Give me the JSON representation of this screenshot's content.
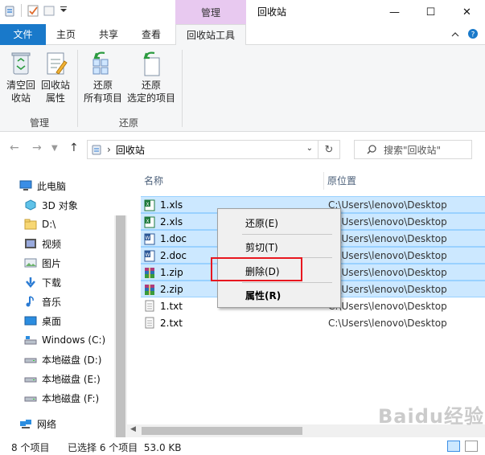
{
  "window": {
    "title": "回收站",
    "contextual_tab_group": "管理",
    "minimize": "—",
    "maximize": "☐",
    "close": "✕"
  },
  "tabs": {
    "file": "文件",
    "home": "主页",
    "share": "共享",
    "view": "查看",
    "recycle_tools": "回收站工具"
  },
  "ribbon": {
    "empty_bin_line1": "清空回",
    "empty_bin_line2": "收站",
    "bin_props_line1": "回收站",
    "bin_props_line2": "属性",
    "group_manage": "管理",
    "restore_all_line1": "还原",
    "restore_all_line2": "所有项目",
    "restore_sel_line1": "还原",
    "restore_sel_line2": "选定的项目",
    "group_restore": "还原"
  },
  "address": {
    "path": "回收站",
    "search_placeholder": "搜索\"回收站\""
  },
  "nav": {
    "items": [
      {
        "label": "此电脑"
      },
      {
        "label": "3D 对象"
      },
      {
        "label": "D:\\"
      },
      {
        "label": "视频"
      },
      {
        "label": "图片"
      },
      {
        "label": "下载"
      },
      {
        "label": "音乐"
      },
      {
        "label": "桌面"
      },
      {
        "label": "Windows (C:)"
      },
      {
        "label": "本地磁盘 (D:)"
      },
      {
        "label": "本地磁盘 (E:)"
      },
      {
        "label": "本地磁盘 (F:)"
      },
      {
        "label": "网络"
      }
    ]
  },
  "columns": {
    "name": "名称",
    "location": "原位置"
  },
  "files": [
    {
      "name": "1.xls",
      "location": "C:\\Users\\lenovo\\Desktop",
      "selected": true,
      "type": "xls"
    },
    {
      "name": "2.xls",
      "location": "C:\\Users\\lenovo\\Desktop",
      "selected": true,
      "type": "xls"
    },
    {
      "name": "1.doc",
      "location": "C:\\Users\\lenovo\\Desktop",
      "selected": true,
      "type": "doc"
    },
    {
      "name": "2.doc",
      "location": "C:\\Users\\lenovo\\Desktop",
      "selected": true,
      "type": "doc"
    },
    {
      "name": "1.zip",
      "location": "C:\\Users\\lenovo\\Desktop",
      "selected": true,
      "type": "zip"
    },
    {
      "name": "2.zip",
      "location": "C:\\Users\\lenovo\\Desktop",
      "selected": true,
      "type": "zip"
    },
    {
      "name": "1.txt",
      "location": "C:\\Users\\lenovo\\Desktop",
      "selected": false,
      "type": "txt"
    },
    {
      "name": "2.txt",
      "location": "C:\\Users\\lenovo\\Desktop",
      "selected": false,
      "type": "txt"
    }
  ],
  "context_menu": {
    "restore": "还原(E)",
    "cut": "剪切(T)",
    "delete": "删除(D)",
    "properties": "属性(R)"
  },
  "status": {
    "count": "8 个项目",
    "selected": "已选择 6 个项目  53.0 KB"
  },
  "watermark": "Baidu经验",
  "colors": {
    "file_tab": "#1979ca",
    "contextual_tab": "#e8c9f0",
    "selection": "#cce8ff",
    "highlight_box": "#e8171f"
  }
}
